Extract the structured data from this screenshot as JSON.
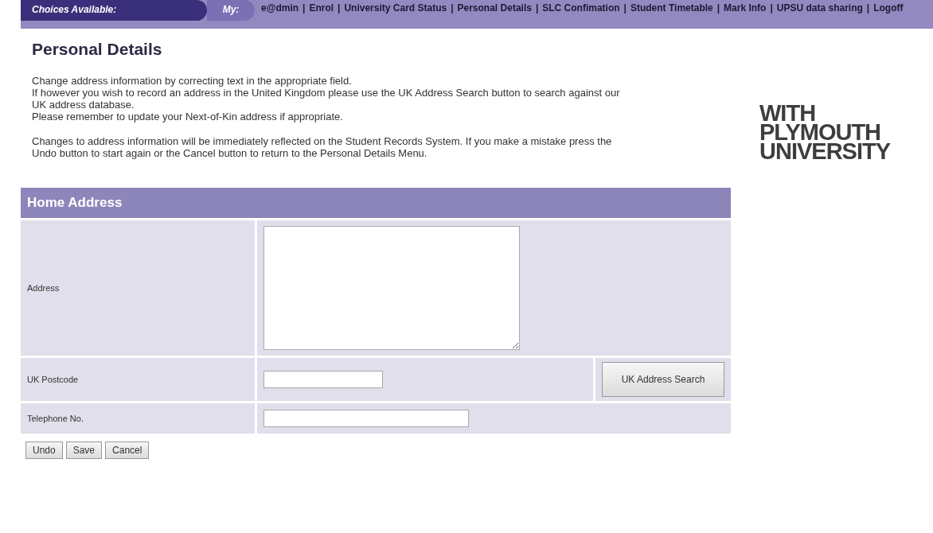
{
  "nav": {
    "label": "Choices Available:",
    "my_label": "My:",
    "separator": "|",
    "links": [
      "e@dmin",
      "Enrol",
      "University Card Status",
      "Personal Details",
      "SLC Confimation",
      "Student Timetable",
      "Mark Info",
      "UPSU data sharing",
      "Logoff"
    ]
  },
  "title": "Personal Details",
  "paragraphs": [
    [
      "Change address information by correcting text in the appropriate field.",
      "If however you wish to record an address in the United Kingdom please use the UK Address Search button to search against our UK address database.",
      "Please remember to update your Next-of-Kin address if appropriate."
    ],
    [
      "Changes to address information will be immediately reflected on the Student Records System.  If you make a mistake press the Undo button to start again or the Cancel button to return to the Personal Details Menu."
    ]
  ],
  "logo": [
    "WITH",
    "PLYMOUTH",
    "UNIVERSITY"
  ],
  "form": {
    "title": "Home Address",
    "rows": [
      {
        "kind": "textarea",
        "label": "Address"
      },
      {
        "kind": "input-with-button",
        "label": "UK Postcode",
        "button": "UK Address Search"
      },
      {
        "kind": "input",
        "label": "Telephone No."
      }
    ]
  },
  "buttons": [
    "Undo",
    "Save",
    "Cancel"
  ]
}
